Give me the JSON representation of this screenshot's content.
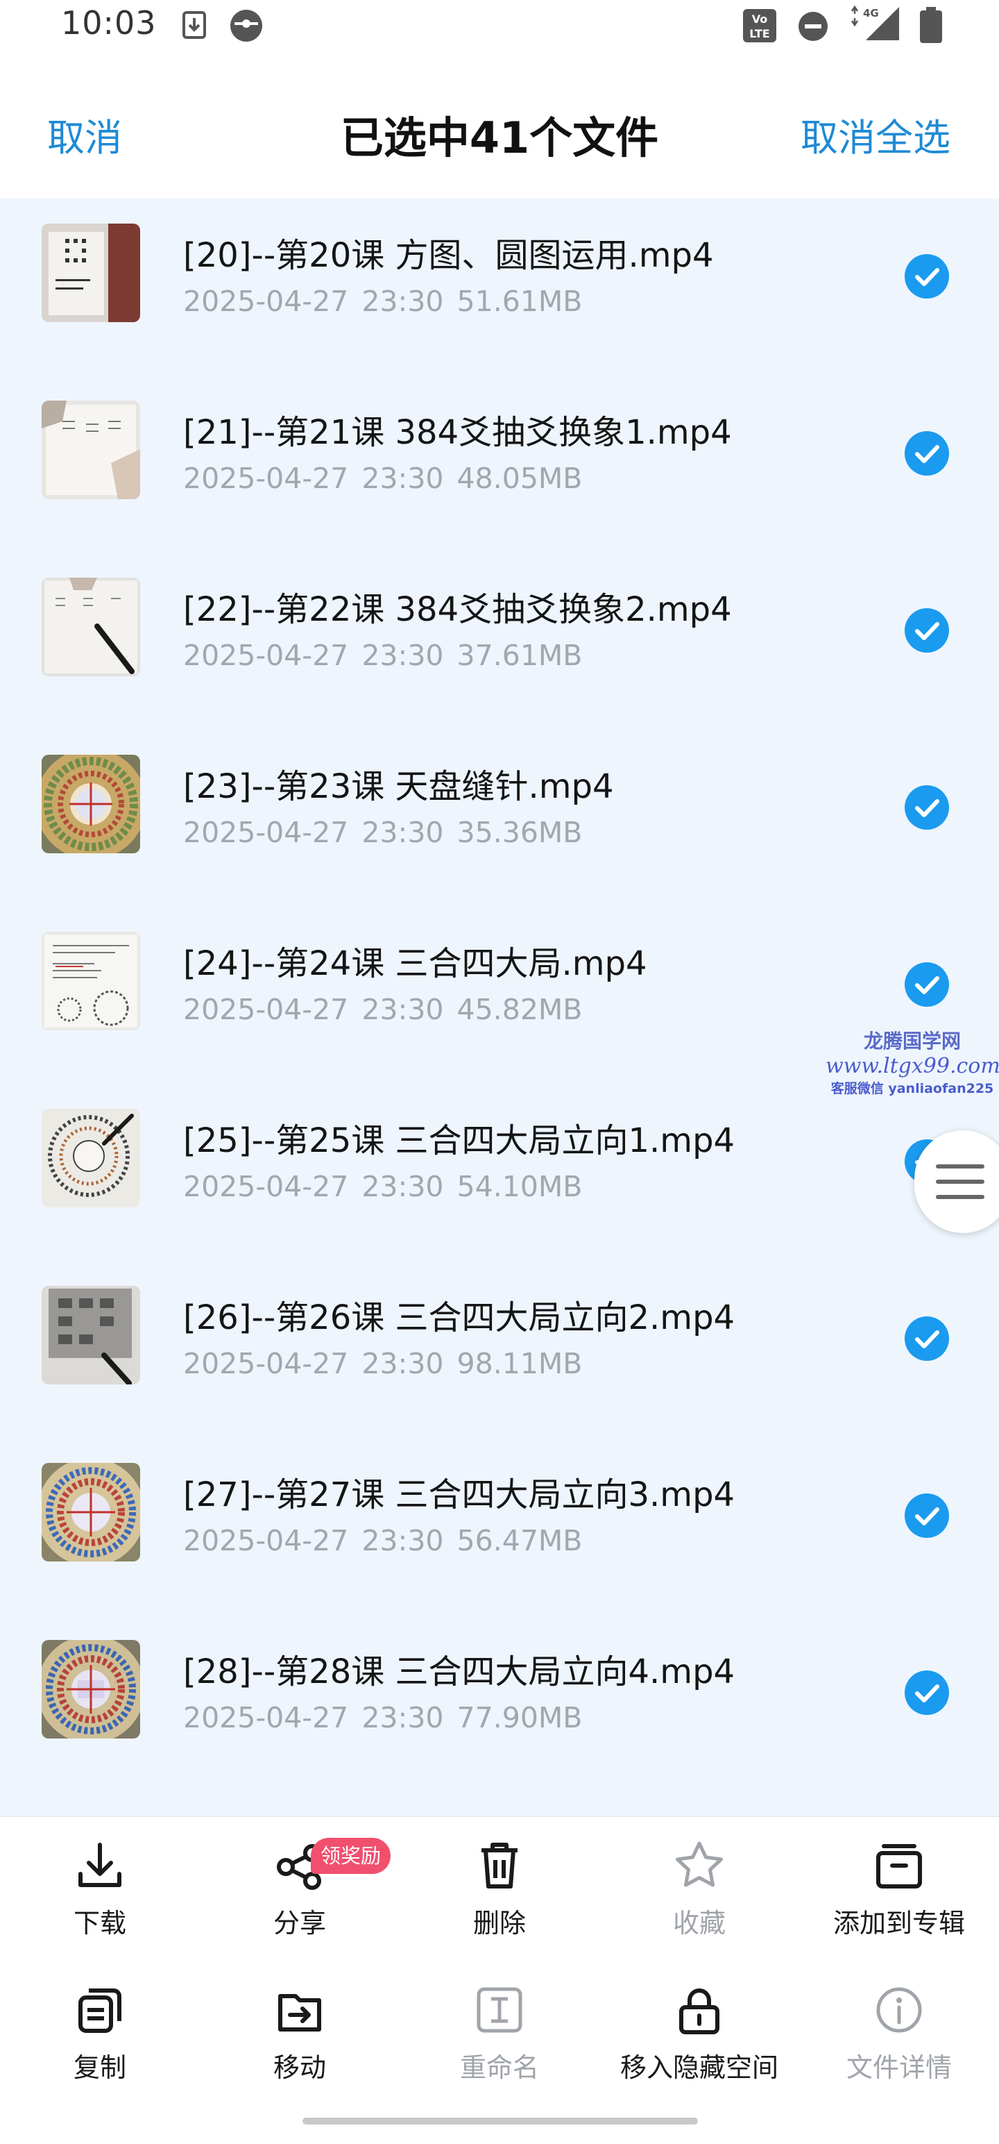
{
  "status_bar": {
    "time": "10:03",
    "network": "4G",
    "icons": [
      "download-notification-icon",
      "pokeball-icon",
      "volte-icon",
      "do-not-disturb-icon",
      "signal-icon",
      "battery-icon"
    ]
  },
  "header": {
    "cancel_label": "取消",
    "title": "已选中41个文件",
    "deselect_all_label": "取消全选"
  },
  "files": [
    {
      "name": "[20]--第20课 方图、圆图运用.mp4",
      "date": "2025-04-27",
      "time": "23:30",
      "size": "51.61MB",
      "selected": true
    },
    {
      "name": "[21]--第21课 384爻抽爻换象1.mp4",
      "date": "2025-04-27",
      "time": "23:30",
      "size": "48.05MB",
      "selected": true
    },
    {
      "name": "[22]--第22课 384爻抽爻换象2.mp4",
      "date": "2025-04-27",
      "time": "23:30",
      "size": "37.61MB",
      "selected": true
    },
    {
      "name": "[23]--第23课 天盘缝针.mp4",
      "date": "2025-04-27",
      "time": "23:30",
      "size": "35.36MB",
      "selected": true
    },
    {
      "name": "[24]--第24课 三合四大局.mp4",
      "date": "2025-04-27",
      "time": "23:30",
      "size": "45.82MB",
      "selected": true
    },
    {
      "name": "[25]--第25课 三合四大局立向1.mp4",
      "date": "2025-04-27",
      "time": "23:30",
      "size": "54.10MB",
      "selected": true
    },
    {
      "name": "[26]--第26课 三合四大局立向2.mp4",
      "date": "2025-04-27",
      "time": "23:30",
      "size": "98.11MB",
      "selected": true
    },
    {
      "name": "[27]--第27课 三合四大局立向3.mp4",
      "date": "2025-04-27",
      "time": "23:30",
      "size": "56.47MB",
      "selected": true
    },
    {
      "name": "[28]--第28课 三合四大局立向4.mp4",
      "date": "2025-04-27",
      "time": "23:30",
      "size": "77.90MB",
      "selected": true
    }
  ],
  "watermark": {
    "line1": "龙腾国学网",
    "line2": "www.ltgx99.com",
    "line3": "客服微信 yanliaofan225"
  },
  "toolbar": {
    "row1": [
      {
        "label": "下载",
        "icon": "download-icon",
        "enabled": true
      },
      {
        "label": "分享",
        "icon": "share-icon",
        "enabled": true,
        "badge": "领奖励"
      },
      {
        "label": "删除",
        "icon": "trash-icon",
        "enabled": true
      },
      {
        "label": "收藏",
        "icon": "star-icon",
        "enabled": false
      },
      {
        "label": "添加到专辑",
        "icon": "album-icon",
        "enabled": true
      }
    ],
    "row2": [
      {
        "label": "复制",
        "icon": "copy-icon",
        "enabled": true
      },
      {
        "label": "移动",
        "icon": "move-icon",
        "enabled": true
      },
      {
        "label": "重命名",
        "icon": "rename-icon",
        "enabled": false
      },
      {
        "label": "移入隐藏空间",
        "icon": "lock-icon",
        "enabled": true
      },
      {
        "label": "文件详情",
        "icon": "info-icon",
        "enabled": false
      }
    ]
  },
  "colors": {
    "accent": "#1e8ad6",
    "check": "#1a9bef",
    "list_background": "#eef5fd",
    "badge": "#f0506e",
    "disabled_text": "#a0a4aa"
  }
}
